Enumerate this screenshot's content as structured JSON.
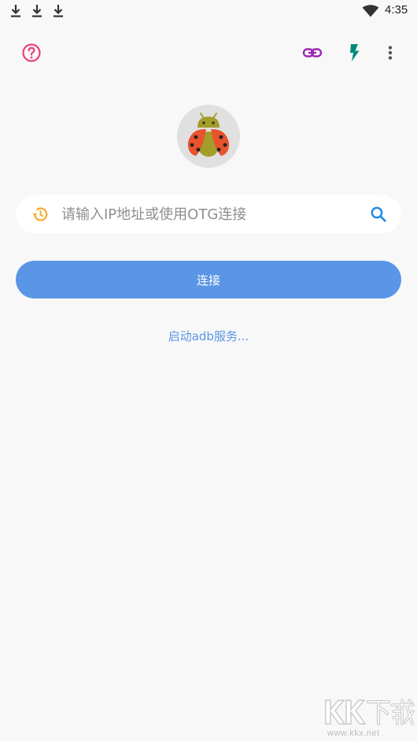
{
  "status_bar": {
    "time": "4:35",
    "notification_icons": [
      "download-icon",
      "download-icon",
      "download-icon"
    ],
    "signal_icon": "wifi-icon"
  },
  "toolbar": {
    "help_icon": "help-circle-icon",
    "link_icon": "link-icon",
    "flash_icon": "flash-icon",
    "menu_icon": "more-vert-icon"
  },
  "logo": {
    "icon": "ladybug-android-logo"
  },
  "search": {
    "placeholder": "请输入IP地址或使用OTG连接",
    "value": "",
    "history_icon": "history-icon",
    "search_icon": "search-icon"
  },
  "connect": {
    "label": "连接"
  },
  "adb": {
    "label": "启动adb服务..."
  },
  "watermark": {
    "logo_text": "KK下载",
    "url": "www.kkx.net"
  },
  "colors": {
    "background": "#f8f8f8",
    "accent_blue": "#5b95e6",
    "help_pink": "#ec407a",
    "link_purple": "#9c27b0",
    "flash_teal": "#00897b",
    "history_amber": "#f9a825",
    "search_blue": "#1e88e5"
  }
}
